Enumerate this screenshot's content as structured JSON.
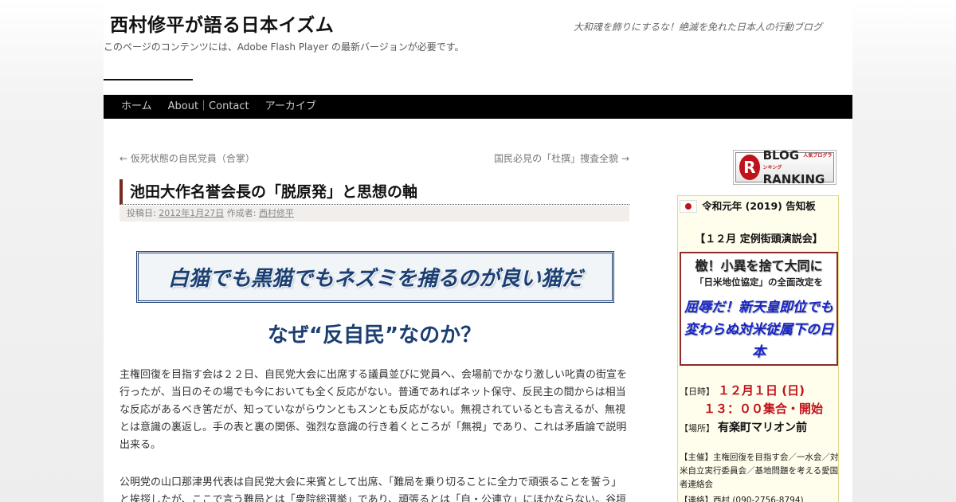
{
  "header": {
    "site_title": "西村修平が語る日本イズム",
    "tagline": "大和魂を飾りにするな！絶滅を免れた日本人の行動ブログ",
    "flash_note": "このページのコンテンツには、Adobe Flash Player の最新バージョンが必要です。"
  },
  "nav": {
    "items": [
      "ホーム",
      "About｜Contact",
      "アーカイブ"
    ]
  },
  "post_nav": {
    "prev": "← 仮死状態の自民党員（合掌）",
    "next": "国民必見の「杜撰」捜査全貌 →"
  },
  "entry": {
    "title": "池田大作名誉会長の「脱原発」と思想の軸",
    "meta": {
      "posted_label": "投稿日:",
      "date": "2012年1月27日",
      "author_label": "作成者:",
      "author": "西村修平"
    },
    "boxed_headline": "白猫でも黒猫でもネズミを捕るのが良い猫だ",
    "subhead": "なぜ“反自民”なのか？",
    "paragraphs": [
      "主権回復を目指す会は２２日、自民党大会に出席する議員並びに党員へ、会場前でかなり激しい叱責の街宣を行ったが、当日のその場でも今においても全く反応がない。普通であればネット保守、反民主の間からは相当な反応があるべき筈だが、知っていながらウンともスンとも反応がない。無視されているとも言えるが、無視とは意識の裏返し。手の表と裏の関係、強烈な意識の行き着くところが「無視」であり、これは矛盾論で説明出来る。",
      "公明党の山口那津男代表は自民党大会に来賓として出席、「難局を乗り切ることに全力で頑張ることを誓う」と挨拶したが、ここで言う難局とは「衆院総選挙」であり、頑張るとは「自・公連立」にほかならない。谷垣"
    ]
  },
  "sidebar": {
    "ranking_badge": {
      "logo_letter": "R",
      "line1": "BLOG",
      "line1_small": "人気ブログランキング",
      "line2": "RANKING"
    },
    "notice_title": "令和元年 (2019) 告知板",
    "event_title": "【１２月 定例街頭演説会】",
    "slogan1": "檄！小異を捨て大同に",
    "slogan2": "「日米地位協定」の全面改定を",
    "slogan3": "屈辱だ！新天皇即位でも変わらぬ対米従属下の日本",
    "date_label": "【日時】",
    "date_value": "１２月１日 (日)",
    "time_value": "１３：００集合・開始",
    "place_label": "【場所】",
    "place_value": "有楽町マリオン前",
    "sponsor": "【主催】主権回復を目指す会／一水会／対米自立実行委員会／基地問題を考える愛国者連絡会",
    "contact": "【連絡】西村 (090-2756-8794)"
  },
  "colors": {
    "nav_bg": "#000000",
    "title_accent": "#7a2a1c",
    "headline_blue": "#1c3f72",
    "event_red": "#c0121b",
    "slogan_blue": "#1a22c8"
  }
}
